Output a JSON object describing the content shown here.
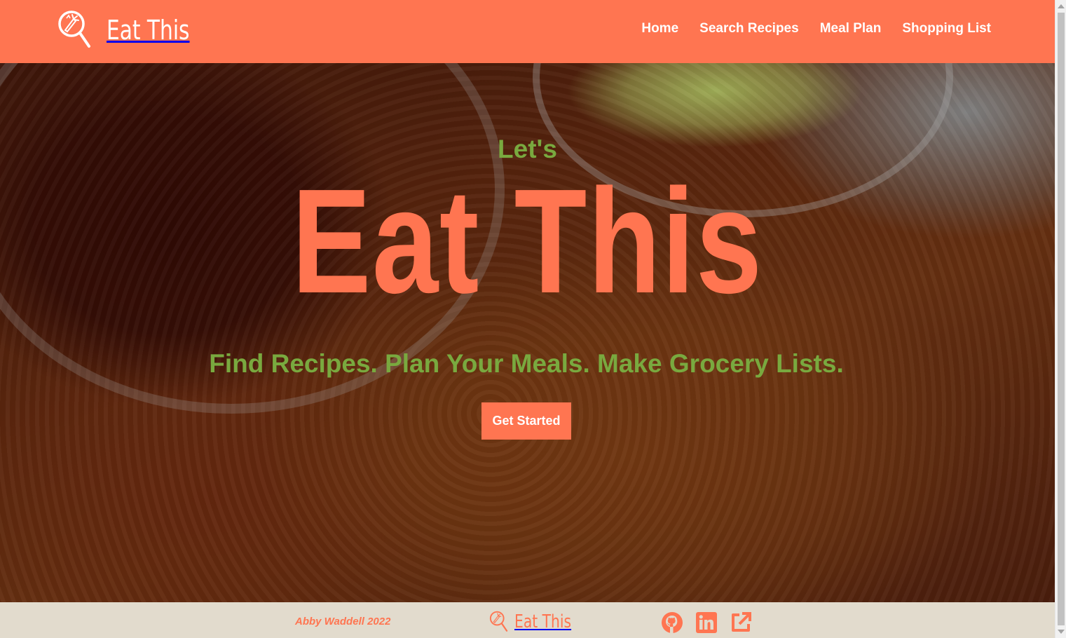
{
  "header": {
    "brand": "Eat This",
    "nav": [
      "Home",
      "Search Recipes",
      "Meal Plan",
      "Shopping List"
    ]
  },
  "hero": {
    "pre_title": "Let's",
    "title": "Eat This",
    "tagline": "Find Recipes. Plan Your Meals. Make Grocery Lists.",
    "cta": "Get Started"
  },
  "footer": {
    "credit": "Abby Waddell 2022",
    "brand": "Eat This",
    "social_icons": [
      "github-icon",
      "linkedin-icon",
      "external-link-icon"
    ]
  },
  "colors": {
    "primary": "#ff7551",
    "accent_green": "#79a93f",
    "footer_bg": "#e2dbcd",
    "white": "#ffffff"
  }
}
